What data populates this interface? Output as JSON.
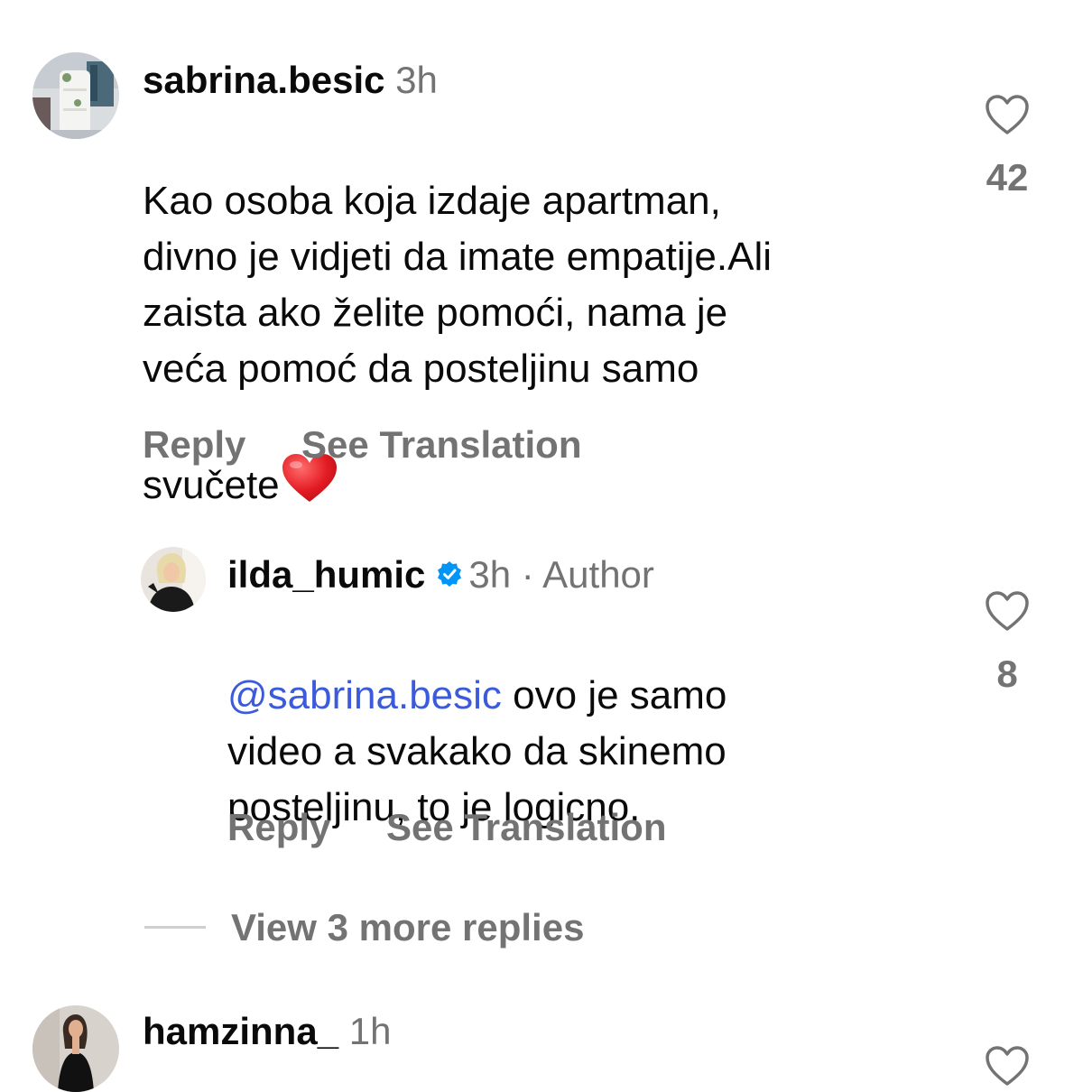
{
  "comments": [
    {
      "username": "sabrina.besic",
      "time": "3h",
      "text": "Kao osoba koja izdaje apartman,\ndivno je vidjeti da imate empatije.Ali\nzaista ako želite pomoći, nama je\nveća pomoć da posteljinu samo\nsvučete",
      "emoji": "heart-emoji",
      "likes": "42",
      "reply_label": "Reply",
      "translate_label": "See Translation"
    }
  ],
  "reply": {
    "username": "ilda_humic",
    "verified": true,
    "time": "3h",
    "separator": "·",
    "author_tag": "Author",
    "mention": "@sabrina.besic",
    "text": " ovo je samo\nvideo a svakako da skinemo\nposteljinu, to je logicno.",
    "likes": "8",
    "reply_label": "Reply",
    "translate_label": "See Translation"
  },
  "view_replies": "View 3 more replies",
  "third_comment": {
    "username": "hamzinna_",
    "time": "1h"
  },
  "colors": {
    "mention": "#3b5bdb",
    "verified": "#0095f6",
    "secondary_text": "#737373"
  }
}
